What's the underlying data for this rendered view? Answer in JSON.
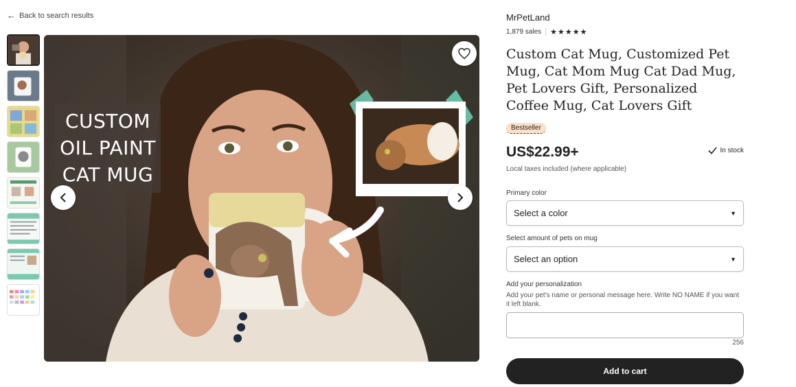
{
  "nav": {
    "back_label": "Back to search results"
  },
  "gallery": {
    "overlay_lines": [
      "CUSTOM",
      "OIL PAINT",
      "CAT MUG"
    ],
    "thumb_count": 8
  },
  "shop": {
    "name": "MrPetLand",
    "sales": "1,879 sales",
    "rating_stars": "★★★★★"
  },
  "product": {
    "title": "Custom Cat Mug, Customized Pet Mug, Cat Mom Mug Cat Dad Mug, Pet Lovers Gift, Personalized Coffee Mug, Cat Lovers Gift",
    "badge": "Bestseller",
    "price": "US$22.99+",
    "stock": "In stock",
    "taxes": "Local taxes included (where applicable)"
  },
  "options": {
    "primary_color_label": "Primary color",
    "primary_color_value": "Select a color",
    "pets_label": "Select amount of pets on mug",
    "pets_value": "Select an option",
    "personalization_label": "Add your personalization",
    "personalization_help": "Add your pet's name or personal message here. Write NO NAME if you want it left blank.",
    "char_count": "256"
  },
  "actions": {
    "add_to_cart": "Add to cart"
  },
  "colors": {
    "accent_dark": "#222222",
    "badge_bg": "#fde0c7"
  }
}
